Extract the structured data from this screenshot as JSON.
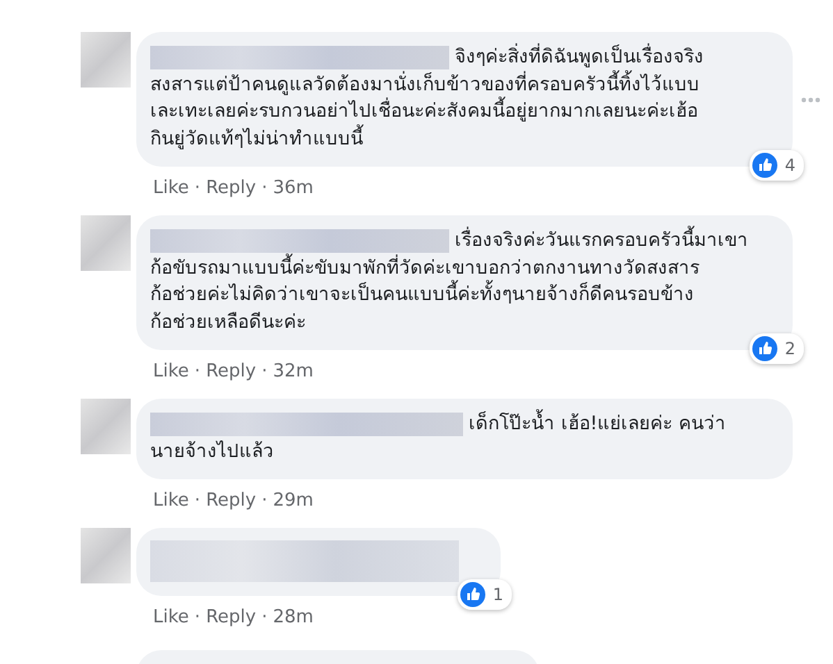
{
  "comments": [
    {
      "lines": [
        "จิงๆค่ะสิ่งที่ดิฉันพูดเป็นเรื่องจริง",
        "สงสารแต่ป้าคนดูแลวัดต้องมานั่งเก็บข้าวของที่ครอบครัวนี้ทิ้งไว้แบบ",
        "เละเทะเลยค่ะรบกวนอย่าไปเชื่อนะค่ะสังคมนี้อยู่ยากมากเลยนะค่ะเฮ้อ",
        "กินยู่วัดแท้ๆไม่น่าทำแบบนี้"
      ],
      "reactions": "4",
      "options_shown": true,
      "actions": [
        "Like",
        "Reply"
      ],
      "time": "36m"
    },
    {
      "lines": [
        "เรื่องจริงค่ะวันแรกครอบครัวนี้มาเขา",
        "ก้อขับรถมาแบบนี้ค่ะขับมาพักที่วัดค่ะเขาบอกว่าตกงานทางวัดสงสาร",
        "ก้อช่วยค่ะไม่คิดว่าเขาจะเป็นคนแบบนี้ค่ะทั้งๆนายจ้างก็ดีคนรอบข้าง",
        "ก้อช่วยเหลือดีนะค่ะ"
      ],
      "reactions": "2",
      "options_shown": false,
      "actions": [
        "Like",
        "Reply"
      ],
      "time": "32m"
    },
    {
      "lines": [
        "เด็กโป๊ะน้ำ เฮ้อ!แย่เลยค่ะ คนว่า",
        "นายจ้างไปแล้ว"
      ],
      "options_shown": false,
      "actions": [
        "Like",
        "Reply"
      ],
      "time": "29m"
    },
    {
      "reactions": "1",
      "options_shown": false,
      "actions": [
        "Like",
        "Reply"
      ],
      "time": "28m"
    }
  ],
  "separator": "·"
}
